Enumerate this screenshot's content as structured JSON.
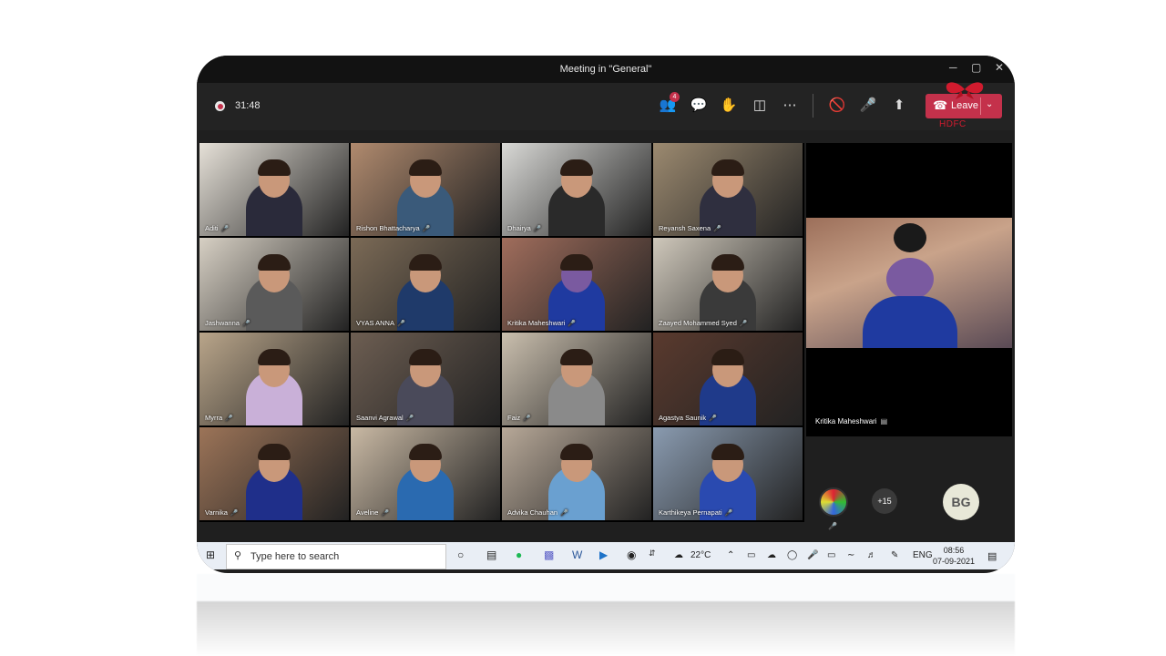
{
  "window": {
    "title": "Meeting in \"General\""
  },
  "toolbar": {
    "timer": "31:48",
    "participants_badge": "4",
    "leave_label": "Leave",
    "logo_brand": "HDFC"
  },
  "participants": [
    {
      "name": "Aditi",
      "bg": "#e6e1d8"
    },
    {
      "name": "Rishon  Bhattacharya",
      "bg": "#b08a6e"
    },
    {
      "name": "Dhairya",
      "bg": "#d9d9d6"
    },
    {
      "name": "Reyansh  Saxena",
      "bg": "#9c8a70"
    },
    {
      "name": "Jashwanna",
      "bg": "#d7d0c4"
    },
    {
      "name": "VYAS  ANNA",
      "bg": "#7b6a56"
    },
    {
      "name": "Kritika  Maheshwari",
      "bg": "#a06d5c"
    },
    {
      "name": "Zaayed Mohammed  Syed",
      "bg": "#cfc8bb"
    },
    {
      "name": "Myrra",
      "bg": "#b9a58a"
    },
    {
      "name": "Saanvi Agrawal",
      "bg": "#6d5e52"
    },
    {
      "name": "Faiz",
      "bg": "#cabfae"
    },
    {
      "name": "Agastya Saunik",
      "bg": "#5a3a2e"
    },
    {
      "name": "Varnika",
      "bg": "#9c7458"
    },
    {
      "name": "Aveline",
      "bg": "#c9b9a4"
    },
    {
      "name": "Advika Chauhan",
      "bg": "#b7a898"
    },
    {
      "name": "Karthikeya Pernapati",
      "bg": "#8a9bb0"
    }
  ],
  "spotlight": {
    "name": "Kritika  Maheshwari"
  },
  "strip": {
    "more_count": "+15",
    "avatar_initials": "BG"
  },
  "taskbar": {
    "search_placeholder": "Type here to search",
    "temperature": "22°C",
    "language": "ENG",
    "time": "08:56",
    "date": "07-09-2021"
  }
}
